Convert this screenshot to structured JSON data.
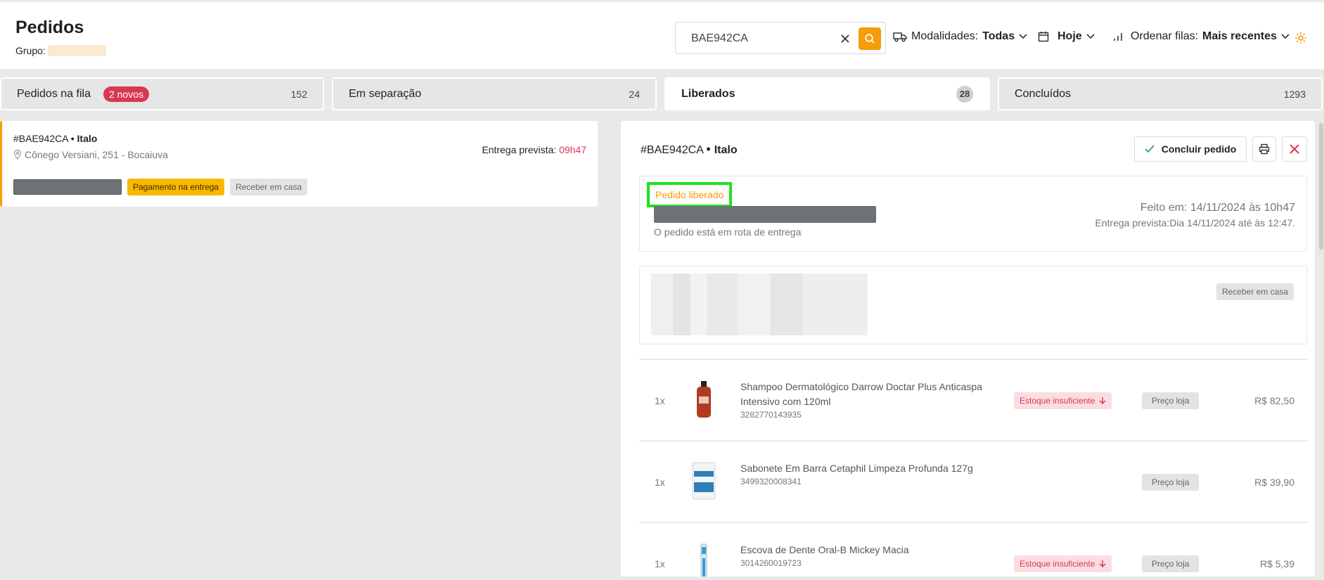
{
  "header": {
    "title": "Pedidos",
    "group_label": "Grupo:",
    "search_value": "BAE942CA",
    "modalities_label": "Modalidades:",
    "modalities_value": "Todas",
    "date_value": "Hoje",
    "sort_label": "Ordenar filas:",
    "sort_value": "Mais recentes",
    "accent_color": "#f59c0b"
  },
  "tabs": [
    {
      "label": "Pedidos na fila",
      "badge": "2 novos",
      "count": "152"
    },
    {
      "label": "Em separação",
      "count": "24"
    },
    {
      "label": "Liberados",
      "count": "28",
      "active": true
    },
    {
      "label": "Concluídos",
      "count": "1293"
    }
  ],
  "order_card": {
    "id": "#BAE942CA",
    "customer": "• Italo",
    "address": "Cônego Versiani, 251 - Bocaiuva",
    "eta_label": "Entrega prevista:",
    "eta_value": "09h47",
    "payment_tag": "Pagamento na entrega",
    "delivery_tag": "Receber em casa"
  },
  "detail": {
    "id": "#BAE942CA",
    "customer": "Italo",
    "conclude_label": "Concluir pedido",
    "status": {
      "label": "Pedido liberado",
      "subtitle": "O pedido está em rota de entrega",
      "made_at": "Feito em: 14/11/2024 às 10h47",
      "eta": "Entrega prevista:Dia 14/11/2024 até às 12:47."
    },
    "customer_box": {
      "delivery_tag": "Receber em casa"
    },
    "items": [
      {
        "qty": "1x",
        "name": "Shampoo Dermatológico Darrow Doctar Plus Anticaspa Intensivo com 120ml",
        "sku": "3282770143935",
        "stock": "Estoque insuficiente",
        "price_tag": "Preço loja",
        "price": "R$ 82,50",
        "img_color": "#b23a22"
      },
      {
        "qty": "1x",
        "name": "Sabonete Em Barra Cetaphil Limpeza Profunda 127g",
        "sku": "3499320008341",
        "stock": "",
        "price_tag": "Preço loja",
        "price": "R$ 39,90",
        "img_color": "#2d7fb8"
      },
      {
        "qty": "1x",
        "name": "Escova de Dente Oral-B Mickey Macia",
        "sku": "3014260019723",
        "stock": "Estoque insuficiente",
        "price_tag": "Preço loja",
        "price": "R$ 5,39",
        "img_color": "#3a9ad9"
      }
    ]
  }
}
